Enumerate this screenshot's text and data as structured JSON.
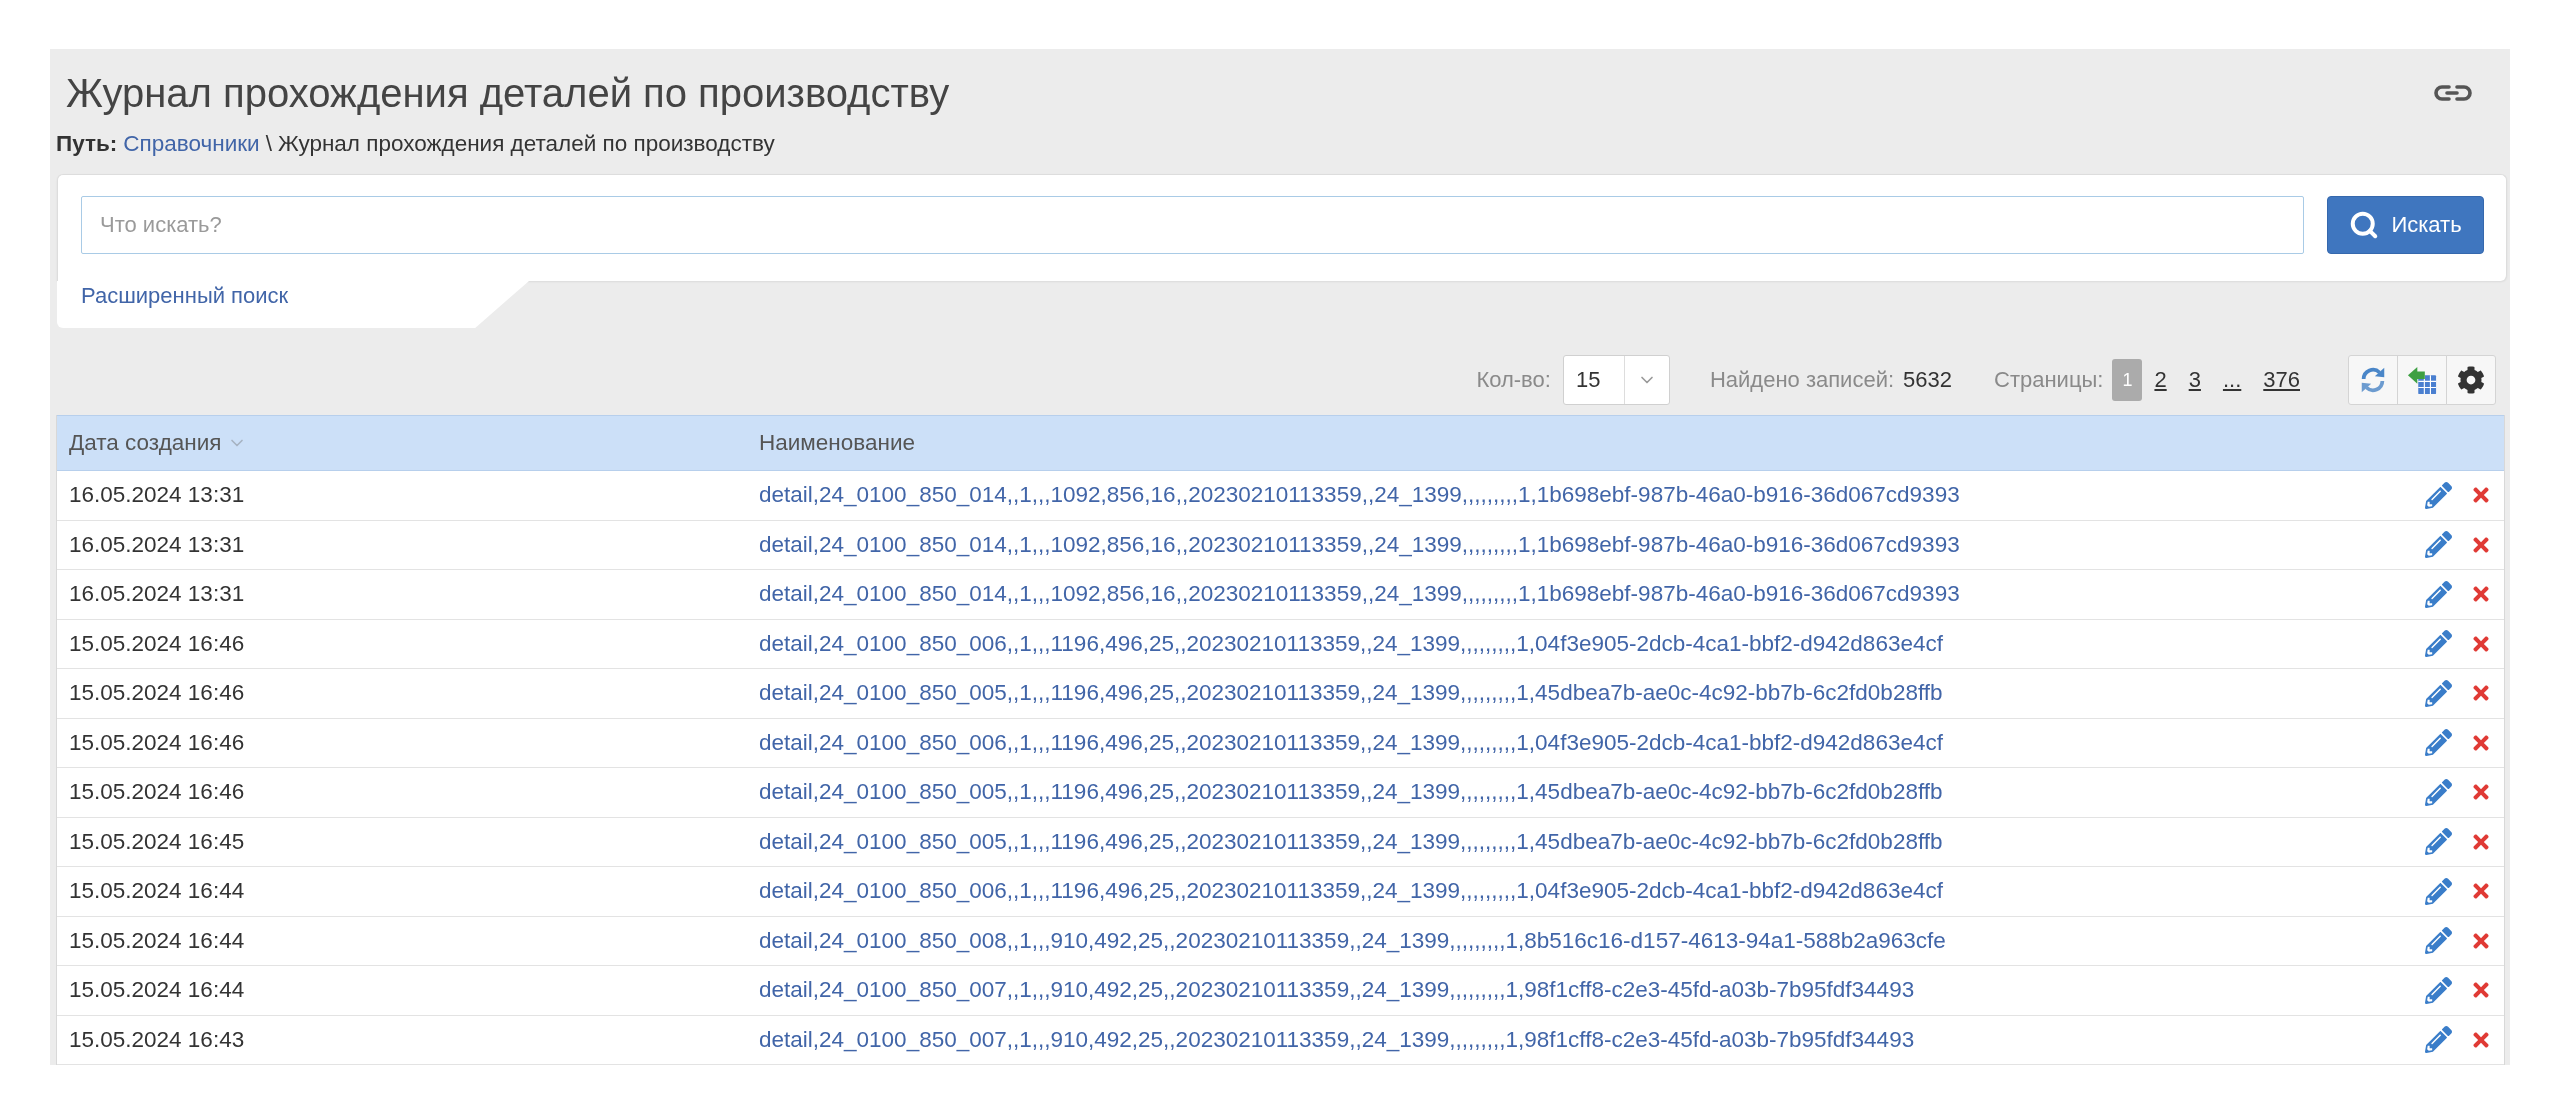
{
  "header": {
    "title": "Журнал прохождения деталей по производству"
  },
  "breadcrumb": {
    "label": "Путь:",
    "separator": "\\",
    "items": [
      {
        "text": "Справочники",
        "kind": "link"
      },
      {
        "text": "Журнал прохождения деталей по производству",
        "kind": "current"
      }
    ]
  },
  "search": {
    "placeholder": "Что искать?",
    "button": "Искать",
    "advanced_link": "Расширенный поиск"
  },
  "toolbar": {
    "page_size_label": "Кол-во:",
    "page_size": "15",
    "found_label": "Найдено записей:",
    "found_count": "5632",
    "pages_label": "Страницы:",
    "pages": [
      {
        "label": "1",
        "selected": true
      },
      {
        "label": "2",
        "selected": false
      },
      {
        "label": "3",
        "selected": false
      },
      {
        "label": "...",
        "selected": false
      },
      {
        "label": "376",
        "selected": false
      }
    ]
  },
  "table": {
    "columns": [
      {
        "label": "Дата создания",
        "sorted": true
      },
      {
        "label": "Наименование",
        "sorted": false
      }
    ],
    "rows": [
      {
        "date": "16.05.2024 13:31",
        "name": "detail,24_0100_850_014,,1,,,1092,856,16,,20230210113359,,24_1399,,,,,,,,,1,1b698ebf-987b-46a0-b916-36d067cd9393"
      },
      {
        "date": "16.05.2024 13:31",
        "name": "detail,24_0100_850_014,,1,,,1092,856,16,,20230210113359,,24_1399,,,,,,,,,1,1b698ebf-987b-46a0-b916-36d067cd9393"
      },
      {
        "date": "16.05.2024 13:31",
        "name": "detail,24_0100_850_014,,1,,,1092,856,16,,20230210113359,,24_1399,,,,,,,,,1,1b698ebf-987b-46a0-b916-36d067cd9393"
      },
      {
        "date": "15.05.2024 16:46",
        "name": "detail,24_0100_850_006,,1,,,1196,496,25,,20230210113359,,24_1399,,,,,,,,,1,04f3e905-2dcb-4ca1-bbf2-d942d863e4cf"
      },
      {
        "date": "15.05.2024 16:46",
        "name": "detail,24_0100_850_005,,1,,,1196,496,25,,20230210113359,,24_1399,,,,,,,,,1,45dbea7b-ae0c-4c92-bb7b-6c2fd0b28ffb"
      },
      {
        "date": "15.05.2024 16:46",
        "name": "detail,24_0100_850_006,,1,,,1196,496,25,,20230210113359,,24_1399,,,,,,,,,1,04f3e905-2dcb-4ca1-bbf2-d942d863e4cf"
      },
      {
        "date": "15.05.2024 16:46",
        "name": "detail,24_0100_850_005,,1,,,1196,496,25,,20230210113359,,24_1399,,,,,,,,,1,45dbea7b-ae0c-4c92-bb7b-6c2fd0b28ffb"
      },
      {
        "date": "15.05.2024 16:45",
        "name": "detail,24_0100_850_005,,1,,,1196,496,25,,20230210113359,,24_1399,,,,,,,,,1,45dbea7b-ae0c-4c92-bb7b-6c2fd0b28ffb"
      },
      {
        "date": "15.05.2024 16:44",
        "name": "detail,24_0100_850_006,,1,,,1196,496,25,,20230210113359,,24_1399,,,,,,,,,1,04f3e905-2dcb-4ca1-bbf2-d942d863e4cf"
      },
      {
        "date": "15.05.2024 16:44",
        "name": "detail,24_0100_850_008,,1,,,910,492,25,,20230210113359,,24_1399,,,,,,,,,1,8b516c16-d157-4613-94a1-588b2a963cfe"
      },
      {
        "date": "15.05.2024 16:44",
        "name": "detail,24_0100_850_007,,1,,,910,492,25,,20230210113359,,24_1399,,,,,,,,,1,98f1cff8-c2e3-45fd-a03b-7b95fdf34493"
      },
      {
        "date": "15.05.2024 16:43",
        "name": "detail,24_0100_850_007,,1,,,910,492,25,,20230210113359,,24_1399,,,,,,,,,1,98f1cff8-c2e3-45fd-a03b-7b95fdf34493"
      }
    ]
  }
}
